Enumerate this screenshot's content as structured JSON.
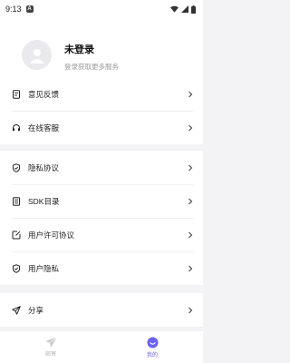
{
  "status_bar": {
    "time": "9:13",
    "notif_badge": "A"
  },
  "profile": {
    "name": "未登录",
    "subtitle": "登录获取更多服务"
  },
  "menu": {
    "group1": [
      {
        "label": "意见反馈",
        "icon": "feedback-icon"
      },
      {
        "label": "在线客服",
        "icon": "headset-icon"
      }
    ],
    "group2": [
      {
        "label": "隐私协议",
        "icon": "shield-icon"
      },
      {
        "label": "SDK目录",
        "icon": "list-doc-icon"
      },
      {
        "label": "用户许可协议",
        "icon": "edit-doc-icon"
      },
      {
        "label": "用户隐私",
        "icon": "shield-icon"
      }
    ],
    "group3": [
      {
        "label": "分享",
        "icon": "send-icon"
      }
    ]
  },
  "tabbar": {
    "tabs": [
      {
        "label": "邮寄",
        "icon": "paper-plane-icon",
        "active": false
      },
      {
        "label": "我的",
        "icon": "smile-icon",
        "active": true
      }
    ]
  },
  "colors": {
    "accent": "#6b62f0",
    "background": "#f3f3f5"
  }
}
